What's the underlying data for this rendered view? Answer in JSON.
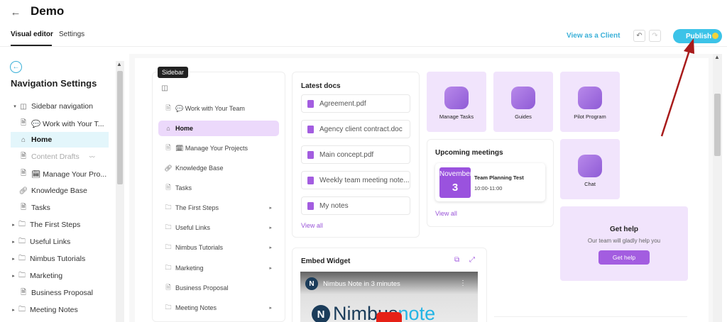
{
  "header": {
    "back_icon": "arrow-left-icon",
    "title": "Demo",
    "tabs": [
      {
        "label": "Visual editor",
        "active": true
      },
      {
        "label": "Settings",
        "active": false
      }
    ],
    "view_as_client": "View as a Client",
    "undo_icon": "undo-icon",
    "redo_icon": "redo-icon",
    "publish_label": "Publish",
    "publish_status_color": "#f4d33a"
  },
  "nav": {
    "back_icon": "circle-arrow-left-icon",
    "title": "Navigation Settings",
    "items": [
      {
        "label": "Sidebar navigation",
        "icon": "sidebar-icon",
        "caret": "▾"
      },
      {
        "label": "💬 Work with Your T...",
        "icon": "page-icon"
      },
      {
        "label": "Home",
        "icon": "home-icon"
      },
      {
        "label": "Content Drafts",
        "icon": "page-icon",
        "badge_icon": "eye-off-icon"
      },
      {
        "label": "🗓 Manage Your Pro...",
        "icon": "page-icon"
      },
      {
        "label": "Knowledge Base",
        "icon": "link-icon"
      },
      {
        "label": "Tasks",
        "icon": "page-icon"
      },
      {
        "label": "The First Steps",
        "icon": "folder-icon",
        "caret": "▸"
      },
      {
        "label": "Useful Links",
        "icon": "folder-icon",
        "caret": "▸"
      },
      {
        "label": "Nimbus Tutorials",
        "icon": "folder-icon",
        "caret": "▸"
      },
      {
        "label": "Marketing",
        "icon": "folder-icon",
        "caret": "▸"
      },
      {
        "label": "Business Proposal",
        "icon": "page-icon"
      },
      {
        "label": "Meeting Notes",
        "icon": "folder-icon",
        "caret": "▸"
      }
    ]
  },
  "sidebar_widget": {
    "tooltip": "Sidebar",
    "items": [
      {
        "label": "💬 Work with Your Team",
        "icon": "page-icon"
      },
      {
        "label": "Home",
        "icon": "home-icon"
      },
      {
        "label": "🗓 Manage Your Projects",
        "icon": "page-icon"
      },
      {
        "label": "Knowledge Base",
        "icon": "link-icon"
      },
      {
        "label": "Tasks",
        "icon": "page-icon"
      },
      {
        "label": "The First Steps",
        "icon": "folder-icon",
        "arrow": "▸"
      },
      {
        "label": "Useful Links",
        "icon": "folder-icon",
        "arrow": "▸"
      },
      {
        "label": "Nimbus Tutorials",
        "icon": "folder-icon",
        "arrow": "▸"
      },
      {
        "label": "Marketing",
        "icon": "folder-icon",
        "arrow": "▸"
      },
      {
        "label": "Business Proposal",
        "icon": "page-icon"
      },
      {
        "label": "Meeting Notes",
        "icon": "folder-icon",
        "arrow": "▸"
      }
    ]
  },
  "latest_docs": {
    "title": "Latest docs",
    "docs": [
      "Agreement.pdf",
      "Agency client contract.doc",
      "Main concept.pdf",
      "Weekly team meeting note...",
      "My notes"
    ],
    "view_all": "View all"
  },
  "tiles": {
    "manage_tasks": "Manage Tasks",
    "guides": "Guides",
    "pilot_program": "Pilot Program",
    "chat": "Chat"
  },
  "meetings": {
    "title": "Upcoming meetings",
    "month": "November",
    "day": "3",
    "name": "Team Planning Test",
    "time": "10:00-11:00",
    "view_all": "View all"
  },
  "help": {
    "title": "Get help",
    "subtitle": "Our team will gladly help you",
    "button": "Get help"
  },
  "embed": {
    "title": "Embed Widget",
    "video_title": "Nimbus Note in 3 minutes",
    "brand_name": "Nimbus",
    "brand_suffix": "note",
    "logo_letter": "N"
  },
  "colors": {
    "accent": "#a35de0",
    "publish": "#3cc3e8",
    "link": "#3bb0d8",
    "annotation_arrow": "#a81b1b"
  }
}
